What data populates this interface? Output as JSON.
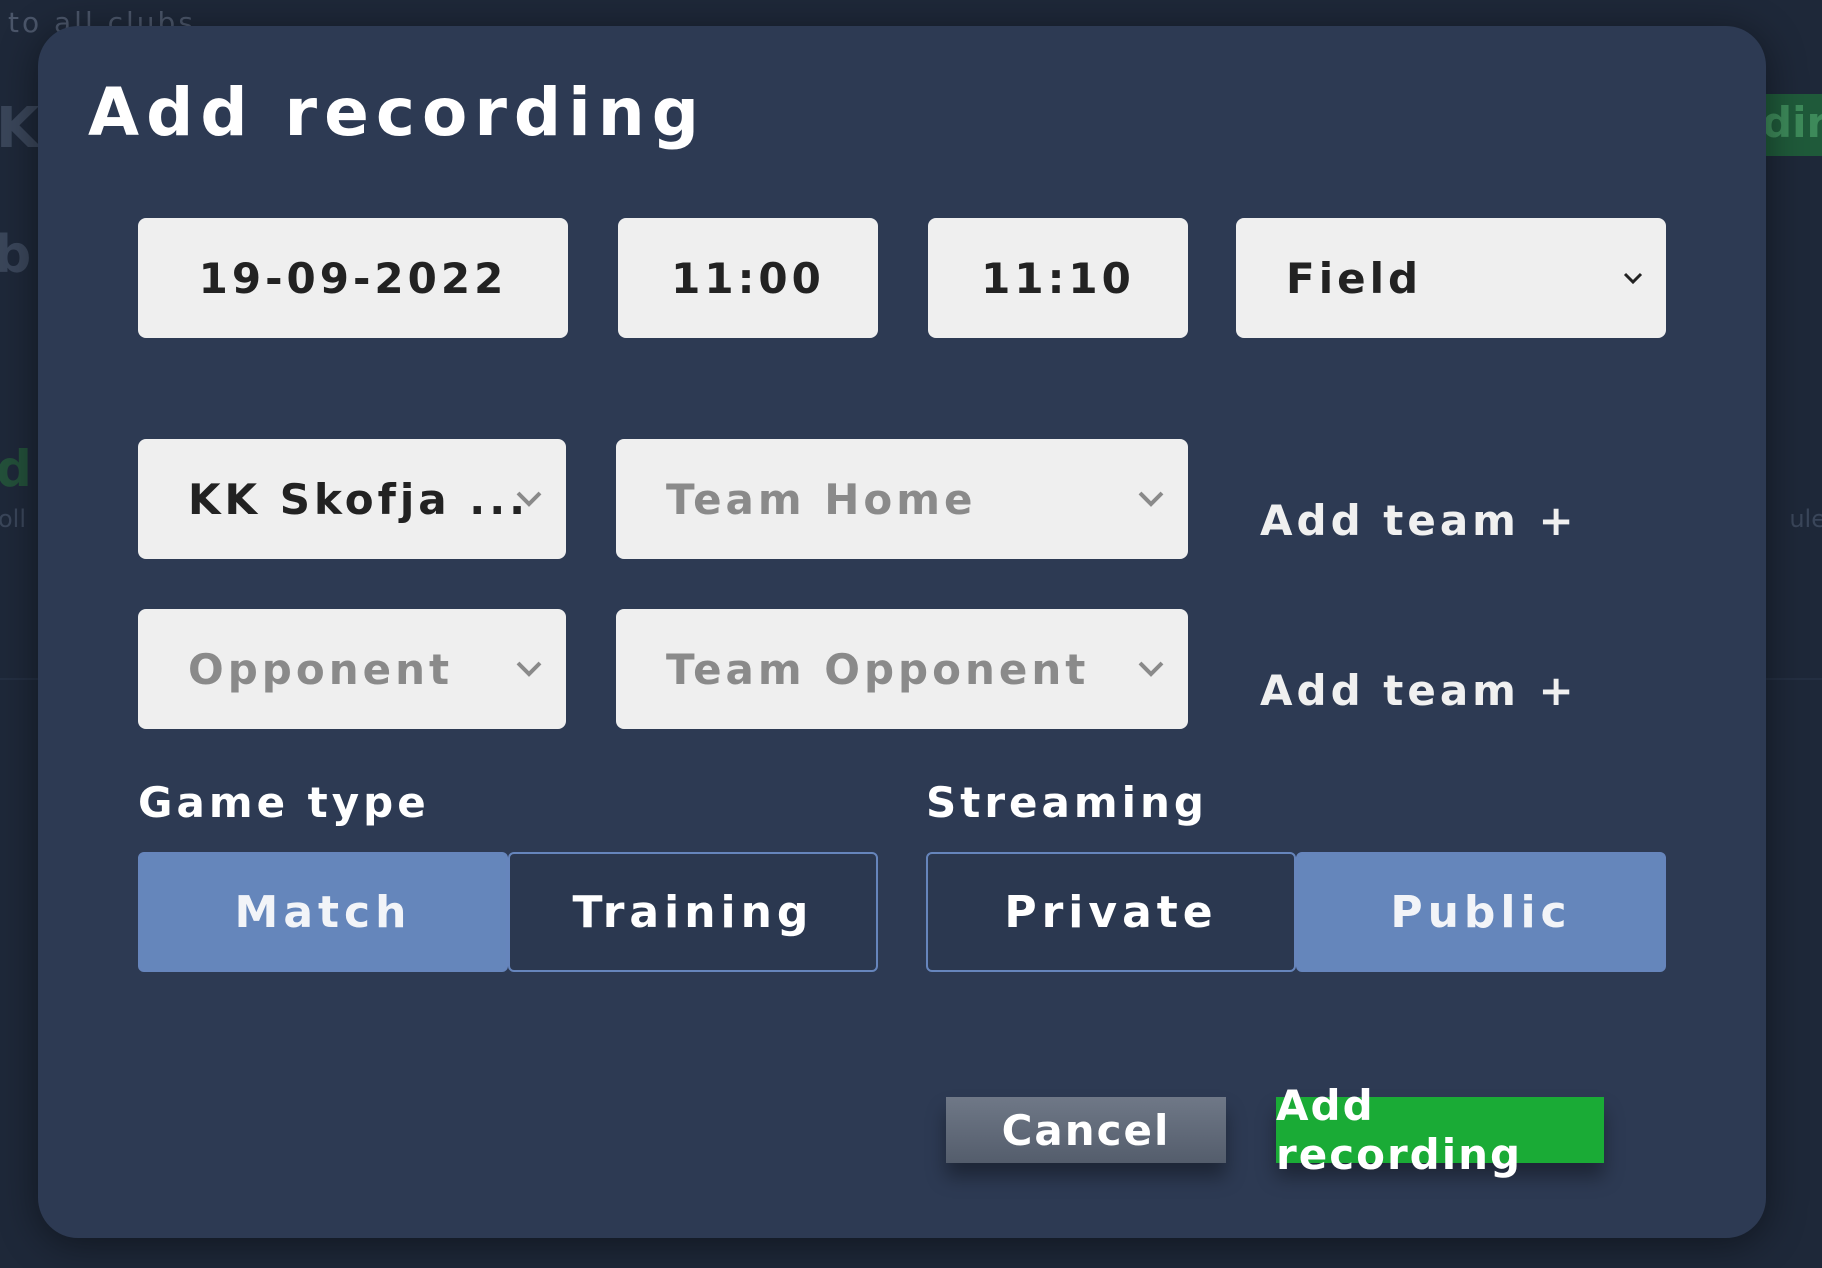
{
  "background": {
    "back_link_fragment": "to all clubs",
    "heading_fragment": "KI",
    "subheading_fragment": "b",
    "green_fragment": "d",
    "text_fragment_left": "oll",
    "button_fragment_right": "dir",
    "text_fragment_right": "ule"
  },
  "modal": {
    "title": "Add recording",
    "date": "19-09-2022",
    "start_time": "11:00",
    "end_time": "11:10",
    "field_select": "Field",
    "home_club_select": "KK Skofja ...",
    "home_team_placeholder": "Team Home",
    "add_team_label_1": "Add team +",
    "opponent_placeholder": "Opponent",
    "opponent_team_placeholder": "Team Opponent",
    "add_team_label_2": "Add team +",
    "game_type": {
      "label": "Game type",
      "options": [
        "Match",
        "Training"
      ],
      "selected": "Match"
    },
    "streaming": {
      "label": "Streaming",
      "options": [
        "Private",
        "Public"
      ],
      "selected": "Public"
    },
    "cancel_label": "Cancel",
    "submit_label": "Add recording"
  },
  "colors": {
    "modal_bg": "#2d3a53",
    "input_bg": "#efefef",
    "segment_active": "#6586bb",
    "submit_green": "#1aab36"
  },
  "icons": {
    "select_arrow": "chevron-down-icon"
  }
}
